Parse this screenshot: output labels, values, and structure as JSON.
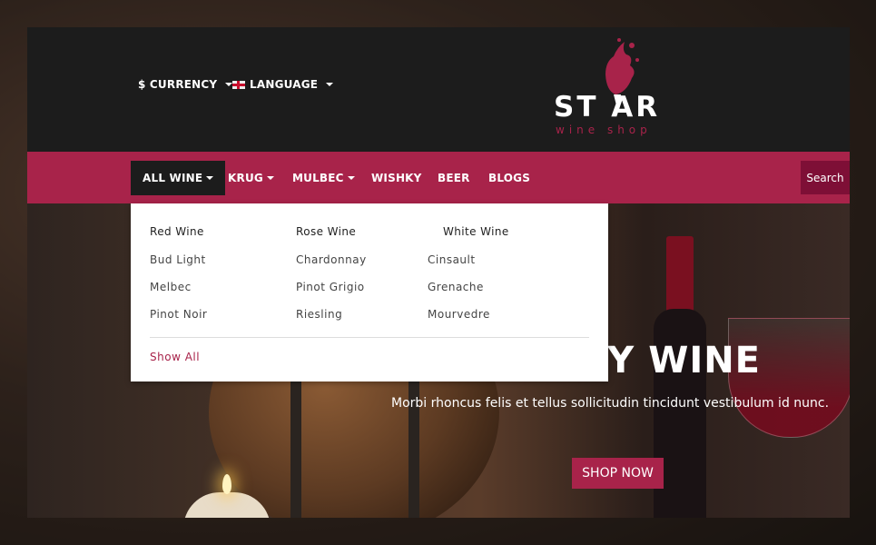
{
  "header": {
    "currency_label": "$ CURRENCY",
    "language_label": "LANGUAGE",
    "logo_text": "ST  AR",
    "logo_subtitle": "wine shop"
  },
  "nav": {
    "items": [
      {
        "label": "ALL WINE",
        "dropdown": true
      },
      {
        "label": "KRUG",
        "dropdown": true
      },
      {
        "label": "MULBEC",
        "dropdown": true
      },
      {
        "label": "WISHKY",
        "dropdown": false
      },
      {
        "label": "BEER",
        "dropdown": false
      },
      {
        "label": "BLOGS",
        "dropdown": false
      }
    ],
    "search_label": "Search"
  },
  "dropdown": {
    "columns": [
      {
        "heading": "Red Wine",
        "links": [
          "Bud Light",
          "Melbec",
          "Pinot Noir"
        ]
      },
      {
        "heading": "Rose Wine",
        "links": [
          "Chardonnay",
          "Pinot Grigio",
          "Riesling"
        ]
      },
      {
        "heading": "White Wine",
        "links": [
          "Cinsault",
          "Grenache",
          "Mourvedre"
        ]
      }
    ],
    "show_all": "Show All"
  },
  "hero": {
    "title": "RY WINE",
    "subtitle": "Morbi rhoncus felis et tellus sollicitudin tincidunt vestibulum id nunc.",
    "button": "SHOP NOW"
  },
  "colors": {
    "accent": "#a8234a",
    "header_bg": "#1c1c1c",
    "search_bg": "#7e0f36"
  }
}
